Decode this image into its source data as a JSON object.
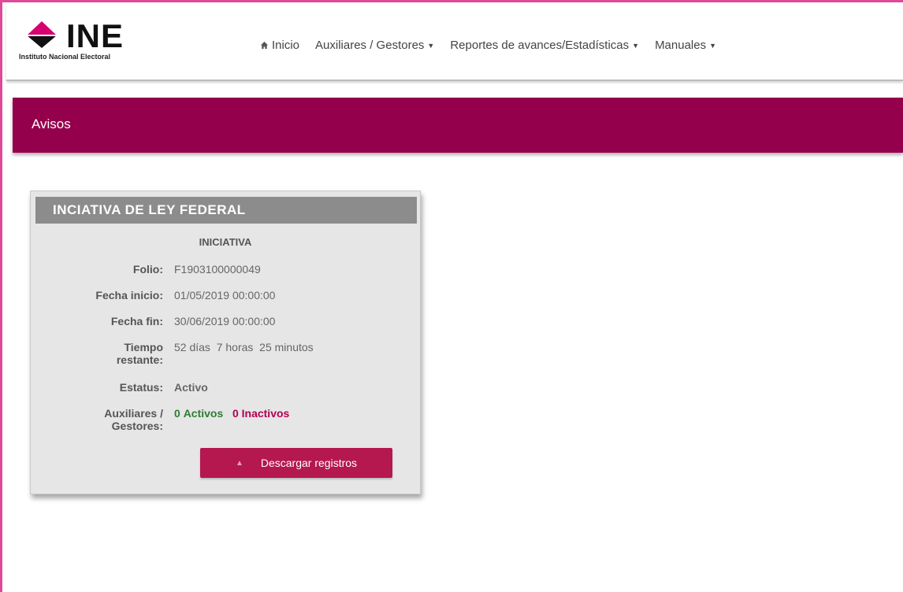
{
  "header": {
    "logo_text": "INE",
    "logo_subtitle": "Instituto Nacional Electoral",
    "nav": [
      {
        "label": "Inicio",
        "icon": "home-icon",
        "dropdown": false
      },
      {
        "label": "Auxiliares / Gestores",
        "dropdown": true
      },
      {
        "label": "Reportes de avances/Estadísticas",
        "dropdown": true
      },
      {
        "label": "Manuales",
        "dropdown": true
      }
    ]
  },
  "banner": {
    "title": "Avisos",
    "color": "#95004c"
  },
  "card": {
    "title": "INCIATIVA DE LEY FEDERAL",
    "subtitle": "INICIATIVA",
    "folio_label": "Folio:",
    "folio": "F1903100000049",
    "fecha_inicio_label": "Fecha inicio:",
    "fecha_inicio": "01/05/2019 00:00:00",
    "fecha_fin_label": "Fecha fin:",
    "fecha_fin": "30/06/2019 00:00:00",
    "tiempo_label_1": "Tiempo",
    "tiempo_label_2": "restante:",
    "tiempo": "52 días  7 horas  25 minutos",
    "estatus_label": "Estatus:",
    "estatus": "Activo",
    "aux_label_1": "Auxiliares /",
    "aux_label_2": "Gestores:",
    "activos_count": "0",
    "activos_label": "Activos",
    "inactivos_count": "0",
    "inactivos_label": "Inactivos",
    "download_button": "Descargar registros"
  },
  "colors": {
    "accent": "#95004c",
    "frame": "#e0489a",
    "button": "#b5174f",
    "active": "#2e7d32",
    "inactive": "#b1004f"
  }
}
